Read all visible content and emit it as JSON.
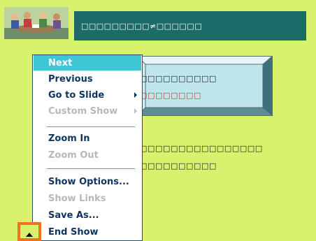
{
  "slide": {
    "title": "□□□□□□□□□≠□□□□□□",
    "box_line_1": "□□□□□□□□□□",
    "box_line_2": "□□□□□□□□",
    "body_line_1": "□□□□□□□□□□□□□□□□",
    "body_line_2": "□□□□□□□□□□"
  },
  "menu": {
    "items": [
      {
        "label": "Next",
        "state": "highlighted"
      },
      {
        "label": "Previous",
        "state": "enabled"
      },
      {
        "label": "Go to Slide",
        "state": "enabled",
        "submenu": true
      },
      {
        "label": "Custom Show",
        "state": "disabled",
        "submenu": true
      },
      {
        "label": "Zoom In",
        "state": "enabled"
      },
      {
        "label": "Zoom Out",
        "state": "disabled"
      },
      {
        "label": "Show Options...",
        "state": "enabled"
      },
      {
        "label": "Show Links",
        "state": "disabled"
      },
      {
        "label": "Save As...",
        "state": "enabled"
      },
      {
        "label": "End Show",
        "state": "enabled"
      }
    ]
  },
  "colors": {
    "slide_background": "#d9f26e",
    "title_bar": "#1d6b68",
    "menu_highlight": "#3ec6d6",
    "menu_text": "#103560",
    "menu_disabled_text": "#b8b8b8",
    "box_red_text": "#d03030",
    "popup_button_border": "#f07320"
  },
  "icons": {
    "popup_button": "triangle-up-icon",
    "submenu": "chevron-right-icon"
  }
}
